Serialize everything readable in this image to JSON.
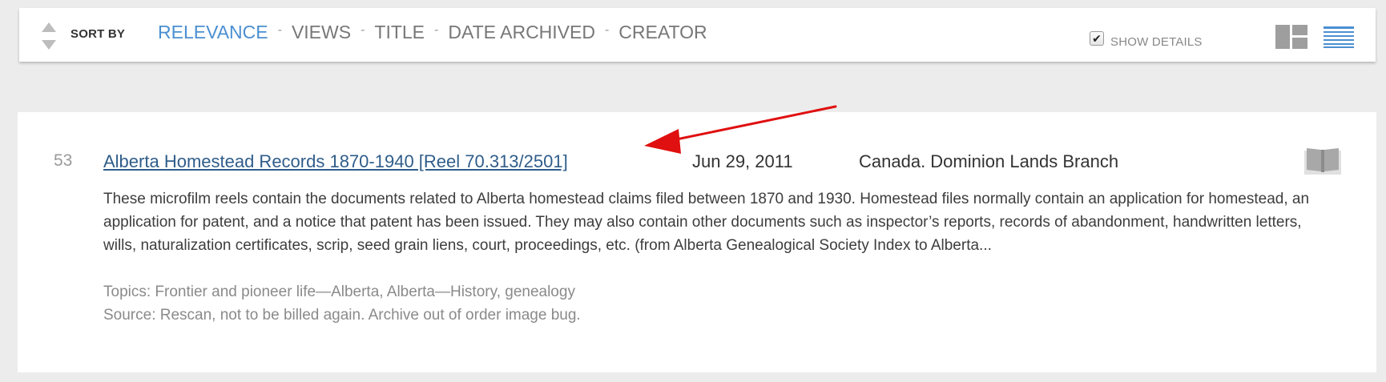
{
  "sort_bar": {
    "label": "SORT BY",
    "options": [
      {
        "label": "RELEVANCE",
        "active": true
      },
      {
        "label": "VIEWS",
        "active": false
      },
      {
        "label": "TITLE",
        "active": false
      },
      {
        "label": "DATE ARCHIVED",
        "active": false
      },
      {
        "label": "CREATOR",
        "active": false
      }
    ],
    "separator": "-",
    "show_details": {
      "label": "SHOW DETAILS",
      "checked": true,
      "check_glyph": "✔"
    },
    "view_modes": [
      "tile-view-icon",
      "list-view-icon"
    ]
  },
  "result": {
    "number": "53",
    "title": "Alberta Homestead Records 1870-1940 [Reel 70.313/2501]",
    "date": "Jun 29, 2011",
    "creator": "Canada. Dominion Lands Branch",
    "media_icon": "book-icon",
    "description": "These microfilm reels contain the documents related to Alberta homestead claims filed between 1870 and 1930. Homestead files normally contain an application for homestead, an application for patent, and a notice that patent has been issued. They may also contain other documents such as inspector’s reports, records of abandonment, handwritten letters, wills, naturalization certificates, scrip, seed grain liens, court, proceedings, etc. (from Alberta Genealogical Society Index to Alberta...",
    "topics": "Topics: Frontier and pioneer life—Alberta, Alberta—History, genealogy",
    "source": "Source: Rescan, not to be billed again. Archive out of order image bug."
  },
  "colors": {
    "page_background": "#ececec",
    "active_sort": "#4b8fd1",
    "link": "#2f5d8a",
    "annotation_arrow": "#e01010",
    "list_view_icon": "#4b8fd1"
  }
}
